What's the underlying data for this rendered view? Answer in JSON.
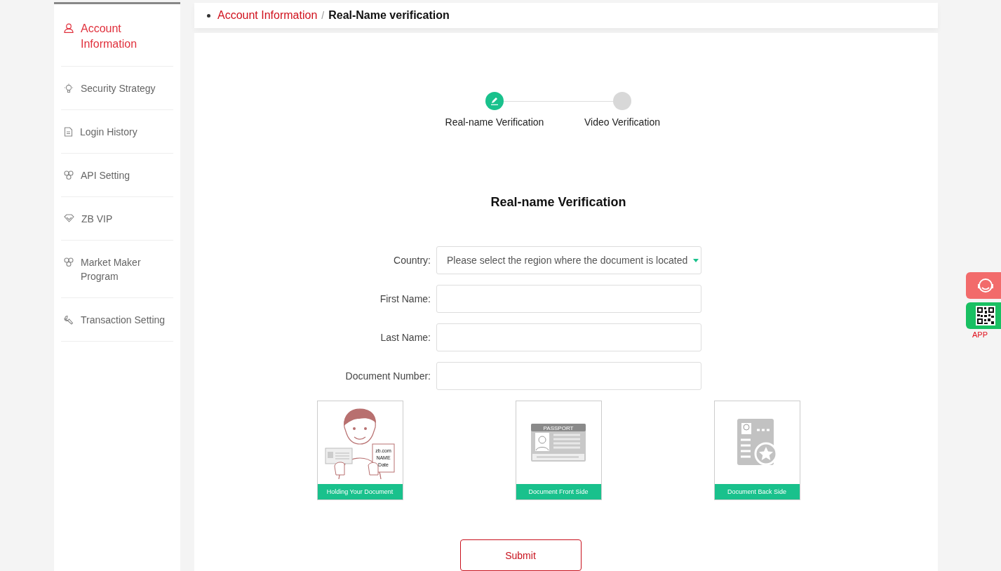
{
  "sidebar": {
    "items": [
      {
        "label": "Account Information",
        "selected": true
      },
      {
        "label": "Security Strategy",
        "selected": false
      },
      {
        "label": "Login History",
        "selected": false
      },
      {
        "label": "API Setting",
        "selected": false
      },
      {
        "label": "ZB VIP",
        "selected": false
      },
      {
        "label": "Market Maker Program",
        "selected": false
      },
      {
        "label": "Transaction Setting",
        "selected": false
      }
    ]
  },
  "breadcrumb": {
    "parent": "Account Information",
    "separator": "/",
    "current": "Real-Name verification"
  },
  "steps": [
    {
      "label": "Real-name Verification",
      "selected": true
    },
    {
      "label": "Video Verification",
      "selected": false
    }
  ],
  "form": {
    "title": "Real-name Verification",
    "fields": [
      {
        "kind": "select",
        "label": "Country:",
        "placeholder": "Please select the region where the document is located"
      },
      {
        "kind": "text",
        "label": "First Name:"
      },
      {
        "kind": "text",
        "label": "Last Name:"
      },
      {
        "kind": "text",
        "label": "Document Number:"
      }
    ],
    "uploads": [
      {
        "kind": "holding",
        "caption": "Holding Your Document",
        "texts": [
          "zb.com",
          "NAME",
          "Date"
        ]
      },
      {
        "kind": "front",
        "caption": "Document Front Side",
        "texts": [
          "PASSPORT"
        ]
      },
      {
        "kind": "back",
        "caption": "Document Back Side"
      }
    ],
    "submit": "Submit"
  },
  "floating": {
    "app_label": "APP"
  }
}
